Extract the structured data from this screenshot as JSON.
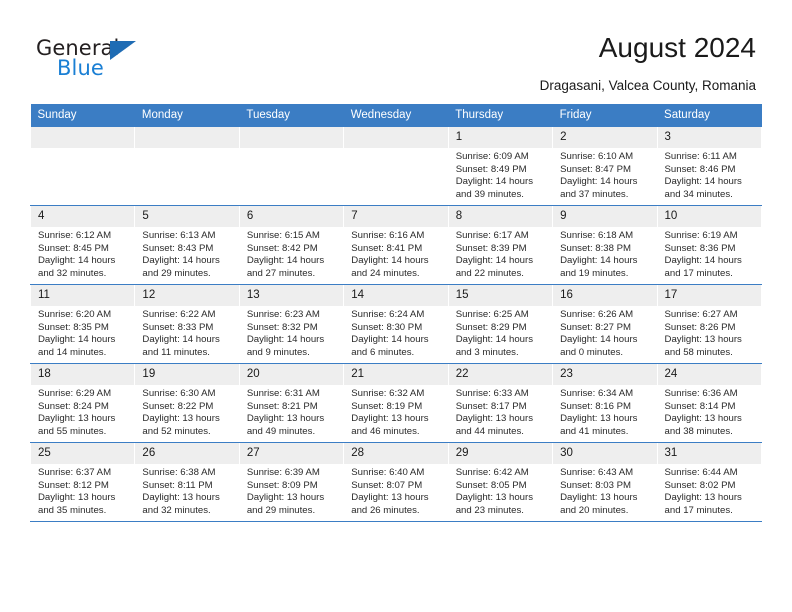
{
  "brand": {
    "name_part1": "General",
    "name_part2": "Blue",
    "accent_color": "#1f6cb4",
    "logo_icon": "triangle-flag-icon"
  },
  "header": {
    "title": "August 2024",
    "subtitle": "Dragasani, Valcea County, Romania"
  },
  "calendar": {
    "header_bg": "#3b7dc4",
    "daynum_bg": "#eeeeee",
    "weekdays": [
      "Sunday",
      "Monday",
      "Tuesday",
      "Wednesday",
      "Thursday",
      "Friday",
      "Saturday"
    ],
    "weeks": [
      [
        {
          "day": "",
          "empty": true
        },
        {
          "day": "",
          "empty": true
        },
        {
          "day": "",
          "empty": true
        },
        {
          "day": "",
          "empty": true
        },
        {
          "day": "1",
          "sunrise": "Sunrise: 6:09 AM",
          "sunset": "Sunset: 8:49 PM",
          "daylight_line1": "Daylight: 14 hours",
          "daylight_line2": "and 39 minutes."
        },
        {
          "day": "2",
          "sunrise": "Sunrise: 6:10 AM",
          "sunset": "Sunset: 8:47 PM",
          "daylight_line1": "Daylight: 14 hours",
          "daylight_line2": "and 37 minutes."
        },
        {
          "day": "3",
          "sunrise": "Sunrise: 6:11 AM",
          "sunset": "Sunset: 8:46 PM",
          "daylight_line1": "Daylight: 14 hours",
          "daylight_line2": "and 34 minutes."
        }
      ],
      [
        {
          "day": "4",
          "sunrise": "Sunrise: 6:12 AM",
          "sunset": "Sunset: 8:45 PM",
          "daylight_line1": "Daylight: 14 hours",
          "daylight_line2": "and 32 minutes."
        },
        {
          "day": "5",
          "sunrise": "Sunrise: 6:13 AM",
          "sunset": "Sunset: 8:43 PM",
          "daylight_line1": "Daylight: 14 hours",
          "daylight_line2": "and 29 minutes."
        },
        {
          "day": "6",
          "sunrise": "Sunrise: 6:15 AM",
          "sunset": "Sunset: 8:42 PM",
          "daylight_line1": "Daylight: 14 hours",
          "daylight_line2": "and 27 minutes."
        },
        {
          "day": "7",
          "sunrise": "Sunrise: 6:16 AM",
          "sunset": "Sunset: 8:41 PM",
          "daylight_line1": "Daylight: 14 hours",
          "daylight_line2": "and 24 minutes."
        },
        {
          "day": "8",
          "sunrise": "Sunrise: 6:17 AM",
          "sunset": "Sunset: 8:39 PM",
          "daylight_line1": "Daylight: 14 hours",
          "daylight_line2": "and 22 minutes."
        },
        {
          "day": "9",
          "sunrise": "Sunrise: 6:18 AM",
          "sunset": "Sunset: 8:38 PM",
          "daylight_line1": "Daylight: 14 hours",
          "daylight_line2": "and 19 minutes."
        },
        {
          "day": "10",
          "sunrise": "Sunrise: 6:19 AM",
          "sunset": "Sunset: 8:36 PM",
          "daylight_line1": "Daylight: 14 hours",
          "daylight_line2": "and 17 minutes."
        }
      ],
      [
        {
          "day": "11",
          "sunrise": "Sunrise: 6:20 AM",
          "sunset": "Sunset: 8:35 PM",
          "daylight_line1": "Daylight: 14 hours",
          "daylight_line2": "and 14 minutes."
        },
        {
          "day": "12",
          "sunrise": "Sunrise: 6:22 AM",
          "sunset": "Sunset: 8:33 PM",
          "daylight_line1": "Daylight: 14 hours",
          "daylight_line2": "and 11 minutes."
        },
        {
          "day": "13",
          "sunrise": "Sunrise: 6:23 AM",
          "sunset": "Sunset: 8:32 PM",
          "daylight_line1": "Daylight: 14 hours",
          "daylight_line2": "and 9 minutes."
        },
        {
          "day": "14",
          "sunrise": "Sunrise: 6:24 AM",
          "sunset": "Sunset: 8:30 PM",
          "daylight_line1": "Daylight: 14 hours",
          "daylight_line2": "and 6 minutes."
        },
        {
          "day": "15",
          "sunrise": "Sunrise: 6:25 AM",
          "sunset": "Sunset: 8:29 PM",
          "daylight_line1": "Daylight: 14 hours",
          "daylight_line2": "and 3 minutes."
        },
        {
          "day": "16",
          "sunrise": "Sunrise: 6:26 AM",
          "sunset": "Sunset: 8:27 PM",
          "daylight_line1": "Daylight: 14 hours",
          "daylight_line2": "and 0 minutes."
        },
        {
          "day": "17",
          "sunrise": "Sunrise: 6:27 AM",
          "sunset": "Sunset: 8:26 PM",
          "daylight_line1": "Daylight: 13 hours",
          "daylight_line2": "and 58 minutes."
        }
      ],
      [
        {
          "day": "18",
          "sunrise": "Sunrise: 6:29 AM",
          "sunset": "Sunset: 8:24 PM",
          "daylight_line1": "Daylight: 13 hours",
          "daylight_line2": "and 55 minutes."
        },
        {
          "day": "19",
          "sunrise": "Sunrise: 6:30 AM",
          "sunset": "Sunset: 8:22 PM",
          "daylight_line1": "Daylight: 13 hours",
          "daylight_line2": "and 52 minutes."
        },
        {
          "day": "20",
          "sunrise": "Sunrise: 6:31 AM",
          "sunset": "Sunset: 8:21 PM",
          "daylight_line1": "Daylight: 13 hours",
          "daylight_line2": "and 49 minutes."
        },
        {
          "day": "21",
          "sunrise": "Sunrise: 6:32 AM",
          "sunset": "Sunset: 8:19 PM",
          "daylight_line1": "Daylight: 13 hours",
          "daylight_line2": "and 46 minutes."
        },
        {
          "day": "22",
          "sunrise": "Sunrise: 6:33 AM",
          "sunset": "Sunset: 8:17 PM",
          "daylight_line1": "Daylight: 13 hours",
          "daylight_line2": "and 44 minutes."
        },
        {
          "day": "23",
          "sunrise": "Sunrise: 6:34 AM",
          "sunset": "Sunset: 8:16 PM",
          "daylight_line1": "Daylight: 13 hours",
          "daylight_line2": "and 41 minutes."
        },
        {
          "day": "24",
          "sunrise": "Sunrise: 6:36 AM",
          "sunset": "Sunset: 8:14 PM",
          "daylight_line1": "Daylight: 13 hours",
          "daylight_line2": "and 38 minutes."
        }
      ],
      [
        {
          "day": "25",
          "sunrise": "Sunrise: 6:37 AM",
          "sunset": "Sunset: 8:12 PM",
          "daylight_line1": "Daylight: 13 hours",
          "daylight_line2": "and 35 minutes."
        },
        {
          "day": "26",
          "sunrise": "Sunrise: 6:38 AM",
          "sunset": "Sunset: 8:11 PM",
          "daylight_line1": "Daylight: 13 hours",
          "daylight_line2": "and 32 minutes."
        },
        {
          "day": "27",
          "sunrise": "Sunrise: 6:39 AM",
          "sunset": "Sunset: 8:09 PM",
          "daylight_line1": "Daylight: 13 hours",
          "daylight_line2": "and 29 minutes."
        },
        {
          "day": "28",
          "sunrise": "Sunrise: 6:40 AM",
          "sunset": "Sunset: 8:07 PM",
          "daylight_line1": "Daylight: 13 hours",
          "daylight_line2": "and 26 minutes."
        },
        {
          "day": "29",
          "sunrise": "Sunrise: 6:42 AM",
          "sunset": "Sunset: 8:05 PM",
          "daylight_line1": "Daylight: 13 hours",
          "daylight_line2": "and 23 minutes."
        },
        {
          "day": "30",
          "sunrise": "Sunrise: 6:43 AM",
          "sunset": "Sunset: 8:03 PM",
          "daylight_line1": "Daylight: 13 hours",
          "daylight_line2": "and 20 minutes."
        },
        {
          "day": "31",
          "sunrise": "Sunrise: 6:44 AM",
          "sunset": "Sunset: 8:02 PM",
          "daylight_line1": "Daylight: 13 hours",
          "daylight_line2": "and 17 minutes."
        }
      ]
    ]
  }
}
